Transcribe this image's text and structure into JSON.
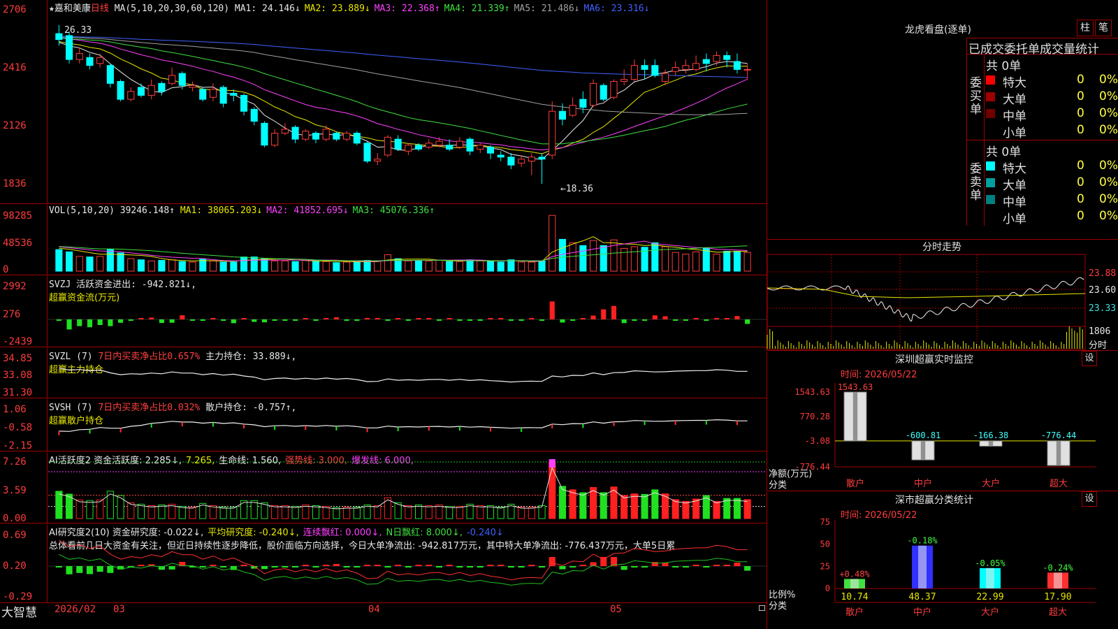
{
  "header": {
    "star": "★",
    "stock": "嘉和美康",
    "period": "日线",
    "ma_def": "MA(5,10,20,30,60,120)",
    "ma": [
      {
        "label": "MA1:",
        "val": "24.146",
        "arrow": "↓",
        "color": "#e8e8e8"
      },
      {
        "label": "MA2:",
        "val": "23.889",
        "arrow": "↓",
        "color": "#e8e800"
      },
      {
        "label": "MA3:",
        "val": "22.368",
        "arrow": "↑",
        "color": "#ff40ff"
      },
      {
        "label": "MA4:",
        "val": "21.339",
        "arrow": "↑",
        "color": "#40e040"
      },
      {
        "label": "MA5:",
        "val": "21.486",
        "arrow": "↓",
        "color": "#a0a0a0"
      },
      {
        "label": "MA6:",
        "val": "23.316",
        "arrow": "↓",
        "color": "#4060ff"
      }
    ]
  },
  "price_axis": [
    "2706",
    "2416",
    "2126",
    "1836"
  ],
  "price_annotations": {
    "high": "26.33",
    "low": "←18.36"
  },
  "vol": {
    "title": "VOL(5,10,20)",
    "val": "39246.148↑",
    "ma": [
      {
        "label": "MA1:",
        "val": "38065.203↓",
        "color": "#e8e800"
      },
      {
        "label": "MA2:",
        "val": "41852.695↓",
        "color": "#ff40ff"
      },
      {
        "label": "MA3:",
        "val": "45076.336↑",
        "color": "#40e040"
      }
    ],
    "axis": [
      "98285",
      "48536",
      "0"
    ]
  },
  "svzj": {
    "line1": "SVZJ  活跃资金进出: -942.821↓,",
    "line2": "超赢资金流(万元)",
    "axis": [
      "2992",
      "276",
      "-2439"
    ]
  },
  "svzl": {
    "prefix": "SVZL (7) ",
    "red": "7日内买卖净占比0.657%",
    "rest": " 主力持仓: 33.889↓,",
    "line2": "超赢主力持仓",
    "axis": [
      "34.85",
      "33.08",
      "31.30"
    ]
  },
  "svsh": {
    "prefix": "SVSH (7) ",
    "red": "7日内买卖净占比0.032%",
    "rest": " 散户持仓: -0.757↑,",
    "line2": "超赢散户持仓",
    "axis": [
      "1.06",
      "-0.58",
      "-2.15"
    ]
  },
  "ai2": {
    "items": [
      {
        "text": "AI活跃度2 资金活跃度: 2.285↓,",
        "color": "#e8e8e8"
      },
      {
        "text": "7.265,",
        "color": "#e8e800"
      },
      {
        "text": "生命线: 1.560,",
        "color": "#e8e8e8"
      },
      {
        "text": "强势线: 3.000,",
        "color": "#ff4040"
      },
      {
        "text": "爆发线: 6.000,",
        "color": "#ff40ff"
      }
    ],
    "axis": [
      "7.26",
      "3.59",
      "0.00"
    ]
  },
  "ai_research": {
    "items": [
      {
        "text": "AI研究度2(10) 资金研究度: -0.022↓,",
        "color": "#e8e8e8"
      },
      {
        "text": "平均研究度: -0.240↓,",
        "color": "#e8e800"
      },
      {
        "text": "连续飘红: 0.000↓,",
        "color": "#ff40ff"
      },
      {
        "text": "N日飘红: 8.000↓,",
        "color": "#40e040"
      },
      {
        "text": "-0.240↓",
        "color": "#4060ff"
      }
    ],
    "summary": "总体看前几日大资金有关注，但近日持续性逐步降低，股价面临方向选择，今日大单净流出: -942.817万元，其中特大单净流出: -776.437万元，大单5日累",
    "axis": [
      "0.69",
      "0.20",
      "-0.29"
    ]
  },
  "footer": {
    "brand": "大智慧",
    "dates": [
      "2026/02",
      "03",
      "04",
      "05"
    ]
  },
  "dragon": {
    "title": "龙虎看盘(逐单)",
    "btn1": "柱",
    "btn2": "笔",
    "tabs": [
      "已成交",
      "委托单",
      "成交量统计"
    ],
    "buy": {
      "label": "委买单",
      "count": "共 0单",
      "rows": [
        {
          "name": "特大",
          "val": "0",
          "pct": "0%",
          "color": "#ff0000"
        },
        {
          "name": "大单",
          "val": "0",
          "pct": "0%",
          "color": "#a00000"
        },
        {
          "name": "中单",
          "val": "0",
          "pct": "0%",
          "color": "#700000"
        },
        {
          "name": "小单",
          "val": "0",
          "pct": "0%",
          "color": ""
        }
      ]
    },
    "sell": {
      "label": "委卖单",
      "count": "共 0单",
      "rows": [
        {
          "name": "特大",
          "val": "0",
          "pct": "0%",
          "color": "#00ffff"
        },
        {
          "name": "大单",
          "val": "0",
          "pct": "0%",
          "color": "#00a0a0"
        },
        {
          "name": "中单",
          "val": "0",
          "pct": "0%",
          "color": "#008080"
        },
        {
          "name": "小单",
          "val": "0",
          "pct": "0%",
          "color": ""
        }
      ]
    }
  },
  "intraday": {
    "title": "分时走势",
    "prices": [
      "23.88",
      "23.60",
      "23.33"
    ],
    "vol": "1806",
    "vol_label": "分时"
  },
  "sz_monitor": {
    "title": "深圳超赢实时监控",
    "btn": "设",
    "time": "时间: 2026/05/22",
    "axis": [
      "1543.63",
      "770.28",
      "-3.08",
      "-776.44"
    ],
    "ylab1": "净额(万元)",
    "ylab2": "分类",
    "bars": [
      {
        "cat": "散户",
        "val": 1543.63,
        "label": "1543.63",
        "color": "#e0e0e0"
      },
      {
        "cat": "中户",
        "val": -600.81,
        "label": "-600.81",
        "color": "#e0e0e0"
      },
      {
        "cat": "大户",
        "val": -166.38,
        "label": "-166.38",
        "color": "#e0e0e0"
      },
      {
        "cat": "超大",
        "val": -776.44,
        "label": "-776.44",
        "color": "#e0e0e0"
      }
    ]
  },
  "sz_stats": {
    "title": "深市超赢分类统计",
    "btn": "设",
    "time": "时间: 2026/05/22",
    "axis": [
      "75",
      "50",
      "25",
      "0"
    ],
    "ylab1": "比例%",
    "ylab2": "分类",
    "bars": [
      {
        "cat": "散户",
        "val": 10.74,
        "label": "10.74",
        "chg": "+0.48%",
        "color": "#40e040"
      },
      {
        "cat": "中户",
        "val": 48.37,
        "label": "48.37",
        "chg": "-0.18%",
        "color": "#3030ff"
      },
      {
        "cat": "大户",
        "val": 22.99,
        "label": "22.99",
        "chg": "-0.05%",
        "color": "#00ffff"
      },
      {
        "cat": "超大",
        "val": 17.9,
        "label": "17.90",
        "chg": "-0.24%",
        "color": "#ff3030"
      }
    ]
  },
  "candles": [
    {
      "o": 25.9,
      "c": 25.6,
      "h": 26.33,
      "l": 25.3
    },
    {
      "o": 25.8,
      "c": 24.6,
      "h": 26.0,
      "l": 24.4
    },
    {
      "o": 24.6,
      "c": 24.9,
      "h": 25.2,
      "l": 24.4
    },
    {
      "o": 24.7,
      "c": 24.3,
      "h": 24.9,
      "l": 24.1
    },
    {
      "o": 24.4,
      "c": 24.7,
      "h": 24.9,
      "l": 24.2
    },
    {
      "o": 24.3,
      "c": 23.4,
      "h": 24.4,
      "l": 23.2
    },
    {
      "o": 23.5,
      "c": 22.6,
      "h": 23.6,
      "l": 22.5
    },
    {
      "o": 22.6,
      "c": 23.0,
      "h": 23.2,
      "l": 22.5
    },
    {
      "o": 23.2,
      "c": 22.8,
      "h": 23.4,
      "l": 22.7
    },
    {
      "o": 22.8,
      "c": 23.3,
      "h": 23.6,
      "l": 22.6
    },
    {
      "o": 23.4,
      "c": 23.0,
      "h": 23.5,
      "l": 22.8
    },
    {
      "o": 23.4,
      "c": 23.8,
      "h": 24.2,
      "l": 23.3
    },
    {
      "o": 23.9,
      "c": 23.3,
      "h": 24.0,
      "l": 23.1
    },
    {
      "o": 23.2,
      "c": 23.3,
      "h": 23.5,
      "l": 23.0
    },
    {
      "o": 23.1,
      "c": 22.6,
      "h": 23.2,
      "l": 22.5
    },
    {
      "o": 22.7,
      "c": 23.1,
      "h": 23.4,
      "l": 22.5
    },
    {
      "o": 23.2,
      "c": 22.4,
      "h": 23.3,
      "l": 22.2
    },
    {
      "o": 22.9,
      "c": 22.8,
      "h": 23.1,
      "l": 22.5
    },
    {
      "o": 22.8,
      "c": 22.0,
      "h": 22.9,
      "l": 21.8
    },
    {
      "o": 22.1,
      "c": 21.5,
      "h": 22.2,
      "l": 21.3
    },
    {
      "o": 21.4,
      "c": 20.3,
      "h": 21.5,
      "l": 20.2
    },
    {
      "o": 20.3,
      "c": 20.9,
      "h": 21.1,
      "l": 20.2
    },
    {
      "o": 20.9,
      "c": 21.1,
      "h": 21.4,
      "l": 20.8
    },
    {
      "o": 21.2,
      "c": 20.6,
      "h": 21.3,
      "l": 20.4
    },
    {
      "o": 20.6,
      "c": 21.0,
      "h": 21.1,
      "l": 20.5
    },
    {
      "o": 20.9,
      "c": 20.6,
      "h": 21.0,
      "l": 20.4
    },
    {
      "o": 20.6,
      "c": 21.1,
      "h": 21.3,
      "l": 20.5
    },
    {
      "o": 20.9,
      "c": 20.6,
      "h": 21.0,
      "l": 20.5
    },
    {
      "o": 20.6,
      "c": 20.9,
      "h": 21.0,
      "l": 20.5
    },
    {
      "o": 20.9,
      "c": 20.4,
      "h": 21.0,
      "l": 20.3
    },
    {
      "o": 20.4,
      "c": 19.5,
      "h": 20.5,
      "l": 19.4
    },
    {
      "o": 19.5,
      "c": 19.6,
      "h": 19.9,
      "l": 19.3
    },
    {
      "o": 19.8,
      "c": 20.7,
      "h": 20.8,
      "l": 19.7
    },
    {
      "o": 20.6,
      "c": 20.1,
      "h": 20.8,
      "l": 20.0
    },
    {
      "o": 20.0,
      "c": 20.3,
      "h": 20.4,
      "l": 19.8
    },
    {
      "o": 20.3,
      "c": 20.1,
      "h": 20.4,
      "l": 20.0
    },
    {
      "o": 20.2,
      "c": 20.4,
      "h": 20.6,
      "l": 20.1
    },
    {
      "o": 20.3,
      "c": 20.5,
      "h": 20.7,
      "l": 20.2
    },
    {
      "o": 20.3,
      "c": 20.1,
      "h": 20.6,
      "l": 20.0
    },
    {
      "o": 20.2,
      "c": 20.5,
      "h": 20.7,
      "l": 20.1
    },
    {
      "o": 20.6,
      "c": 20.0,
      "h": 20.7,
      "l": 19.8
    },
    {
      "o": 20.1,
      "c": 20.3,
      "h": 20.4,
      "l": 19.9
    },
    {
      "o": 20.2,
      "c": 19.9,
      "h": 20.3,
      "l": 19.6
    },
    {
      "o": 19.8,
      "c": 19.7,
      "h": 20.0,
      "l": 19.5
    },
    {
      "o": 19.7,
      "c": 19.3,
      "h": 19.9,
      "l": 19.1
    },
    {
      "o": 19.4,
      "c": 19.6,
      "h": 19.8,
      "l": 19.2
    },
    {
      "o": 19.5,
      "c": 19.7,
      "h": 19.9,
      "l": 18.8
    },
    {
      "o": 19.7,
      "c": 19.6,
      "h": 19.9,
      "l": 18.36
    },
    {
      "o": 19.8,
      "c": 22.0,
      "h": 22.5,
      "l": 19.6
    },
    {
      "o": 22.0,
      "c": 21.6,
      "h": 22.4,
      "l": 21.3
    },
    {
      "o": 21.8,
      "c": 22.3,
      "h": 22.7,
      "l": 21.7
    },
    {
      "o": 22.6,
      "c": 22.2,
      "h": 23.0,
      "l": 21.9
    },
    {
      "o": 22.3,
      "c": 23.4,
      "h": 23.6,
      "l": 22.2
    },
    {
      "o": 23.3,
      "c": 22.6,
      "h": 23.4,
      "l": 22.5
    },
    {
      "o": 22.7,
      "c": 23.5,
      "h": 23.6,
      "l": 22.6
    },
    {
      "o": 23.5,
      "c": 23.6,
      "h": 24.1,
      "l": 23.3
    },
    {
      "o": 23.6,
      "c": 24.3,
      "h": 24.6,
      "l": 23.5
    },
    {
      "o": 24.3,
      "c": 24.1,
      "h": 24.6,
      "l": 23.6
    },
    {
      "o": 24.3,
      "c": 23.8,
      "h": 24.6,
      "l": 23.7
    },
    {
      "o": 23.5,
      "c": 23.9,
      "h": 24.1,
      "l": 23.3
    },
    {
      "o": 24.0,
      "c": 24.2,
      "h": 24.5,
      "l": 23.8
    },
    {
      "o": 24.1,
      "c": 24.3,
      "h": 24.6,
      "l": 23.9
    },
    {
      "o": 24.1,
      "c": 24.4,
      "h": 24.8,
      "l": 24.0
    },
    {
      "o": 24.6,
      "c": 24.4,
      "h": 24.9,
      "l": 24.0
    },
    {
      "o": 24.5,
      "c": 24.8,
      "h": 25.0,
      "l": 24.3
    },
    {
      "o": 24.8,
      "c": 24.6,
      "h": 25.0,
      "l": 24.2
    },
    {
      "o": 24.5,
      "c": 24.1,
      "h": 24.9,
      "l": 23.9
    },
    {
      "o": 24.1,
      "c": 24.1,
      "h": 24.4,
      "l": 23.6
    }
  ],
  "volumes": [
    38,
    34,
    26,
    25,
    26,
    38,
    32,
    22,
    20,
    18,
    19,
    20,
    17,
    16,
    21,
    18,
    16,
    16,
    25,
    25,
    22,
    18,
    18,
    17,
    19,
    18,
    17,
    15,
    16,
    16,
    19,
    18,
    29,
    22,
    18,
    19,
    18,
    19,
    17,
    17,
    20,
    18,
    18,
    16,
    20,
    16,
    16,
    18,
    98,
    56,
    50,
    45,
    54,
    45,
    55,
    40,
    43,
    42,
    50,
    43,
    33,
    30,
    34,
    40,
    30,
    35,
    35,
    33
  ],
  "flows": [
    -40,
    -900,
    -600,
    -700,
    -500,
    -600,
    -300,
    -40,
    50,
    160,
    -320,
    -300,
    370,
    -60,
    -20,
    10,
    -100,
    -340,
    30,
    -220,
    -260,
    -80,
    -10,
    -30,
    40,
    -90,
    60,
    190,
    -60,
    -50,
    80,
    40,
    -30,
    70,
    -40,
    20,
    30,
    -20,
    40,
    -40,
    -60,
    -20,
    40,
    60,
    -30,
    -60,
    30,
    -50,
    1600,
    -280,
    -60,
    110,
    340,
    900,
    1200,
    -330,
    -120,
    -20,
    360,
    280,
    -40,
    -30,
    80,
    -40,
    50,
    60,
    300,
    -400
  ]
}
